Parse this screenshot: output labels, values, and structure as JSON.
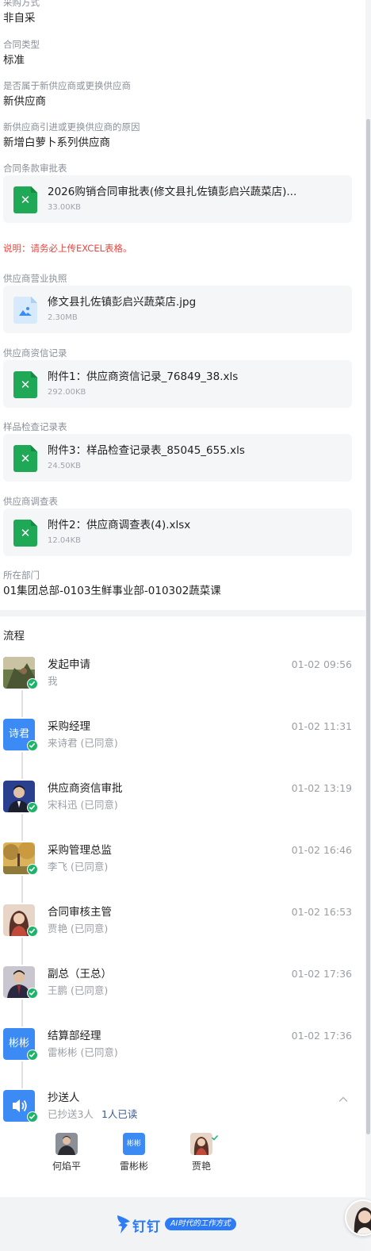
{
  "fields": {
    "purchase_method": {
      "label": "采购方式",
      "value": "非自采"
    },
    "contract_type": {
      "label": "合同类型",
      "value": "标准"
    },
    "new_supplier": {
      "label": "是否属于新供应商或更换供应商",
      "value": "新供应商"
    },
    "reason": {
      "label": "新供应商引进或更换供应商的原因",
      "value": "新增白萝卜系列供应商"
    }
  },
  "attachments": {
    "approval_form": {
      "label": "合同条款审批表",
      "file_name": "2026购销合同审批表(修文县扎佐镇彭启兴蔬菜店)...",
      "file_size": "33.00KB",
      "icon": "excel-file-icon"
    },
    "note": "说明：请务必上传EXCEL表格。",
    "business_license": {
      "label": "供应商营业执照",
      "file_name": "修文县扎佐镇彭启兴蔬菜店.jpg",
      "file_size": "2.30MB",
      "icon": "image-file-icon"
    },
    "credit_record": {
      "label": "供应商资信记录",
      "file_name": "附件1：供应商资信记录_76849_38.xls",
      "file_size": "292.00KB",
      "icon": "excel-file-icon"
    },
    "sample_inspection": {
      "label": "样品检查记录表",
      "file_name": "附件3：样品检查记录表_85045_655.xls",
      "file_size": "24.50KB",
      "icon": "excel-file-icon"
    },
    "supplier_survey": {
      "label": "供应商调查表",
      "file_name": "附件2：供应商调查表(4).xlsx",
      "file_size": "12.04KB",
      "icon": "excel-file-icon"
    }
  },
  "department": {
    "label": "所在部门",
    "value": "01集团总部-0103生鲜事业部-010302蔬菜课"
  },
  "process": {
    "title": "流程",
    "steps": [
      {
        "title": "发起申请",
        "sub": "我",
        "time": "01-02 09:56",
        "avatar": "photo",
        "color": "#6d7a4a"
      },
      {
        "title": "采购经理",
        "sub": "来诗君 (已同意)",
        "time": "01-02 11:31",
        "avatar_text": "诗君"
      },
      {
        "title": "供应商资信审批",
        "sub": "宋科迅 (已同意)",
        "time": "01-02 13:19",
        "avatar": "photo",
        "color": "#2b3f8f"
      },
      {
        "title": "采购管理总监",
        "sub": "李飞 (已同意)",
        "time": "01-02 16:46",
        "avatar": "photo",
        "color": "#b0883c"
      },
      {
        "title": "合同审核主管",
        "sub": "贾艳 (已同意)",
        "time": "01-02 16:53",
        "avatar": "photo",
        "color": "#c9a58f"
      },
      {
        "title": "副总（王总）",
        "sub": "王鹏 (已同意)",
        "time": "01-02 17:36",
        "avatar": "photo",
        "color": "#3a3550"
      },
      {
        "title": "结算部经理",
        "sub": "雷彬彬 (已同意)",
        "time": "01-02 17:36",
        "avatar_text": "彬彬"
      }
    ],
    "cc": {
      "title": "抄送人",
      "count_text": "已抄送3人",
      "read_text": "1人已读",
      "people": [
        {
          "name": "何焰平",
          "avatar": "photo",
          "color": "#3e4046"
        },
        {
          "name": "雷彬彬",
          "avatar_text": "彬彬"
        },
        {
          "name": "贾艳",
          "avatar": "photo",
          "color": "#c9a58f"
        }
      ]
    }
  },
  "footer": {
    "brand_name": "钉钉",
    "slogan": "AI时代的工作方式"
  },
  "colors": {
    "accent": "#3c8bf5",
    "success": "#1fb26b",
    "excel": "#1fa855",
    "note": "#f0443d"
  }
}
